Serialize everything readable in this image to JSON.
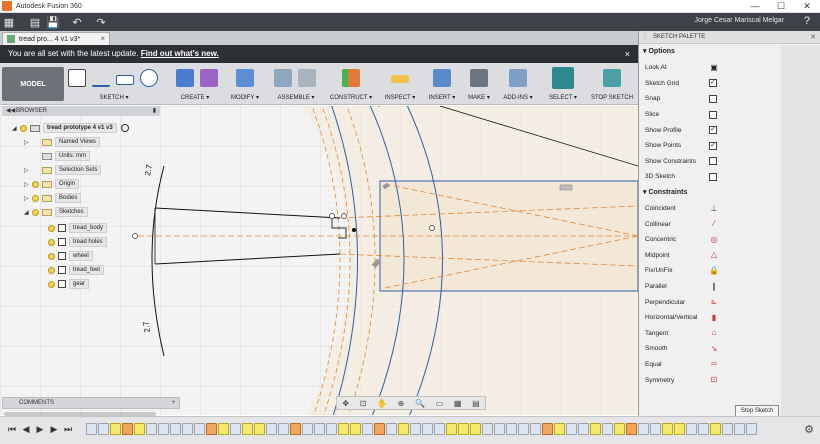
{
  "window": {
    "title": "Autodesk Fusion 360",
    "minimize": "—",
    "maximize": "☐",
    "close": "✕"
  },
  "qat": {
    "user": "Jorge Cesar Mariscal Melgar",
    "grid_icon": "▦",
    "file_icon": "▤",
    "save_icon": "💾",
    "undo_icon": "↶",
    "redo_icon": "↷",
    "help_icon": "?"
  },
  "document_tab": {
    "label": "tread pro... 4 v1 v3*",
    "close": "×"
  },
  "update_banner": {
    "text": "You are all set with the latest update.",
    "link": "Find out what's new.",
    "close": "×"
  },
  "toolbar": {
    "model": "MODEL",
    "groups": [
      "SKETCH ▾",
      "CREATE ▾",
      "MODIFY ▾",
      "ASSEMBLE ▾",
      "CONSTRUCT ▾",
      "INSPECT ▾",
      "INSERT ▾",
      "MAKE ▾",
      "ADD-INS ▾",
      "SELECT ▾",
      "STOP SKETCH"
    ]
  },
  "browser": {
    "header": "BROWSER",
    "root": "tread prototype 4 v1 v3",
    "items": [
      "Named Views",
      "Units: mm",
      "Selection Sets",
      "Origin",
      "Bodies",
      "Sketches"
    ],
    "sketches": [
      "tread_body",
      "tread holes",
      "wheel",
      "tread_feet",
      "gear"
    ]
  },
  "comments": {
    "label": "COMMENTS",
    "plus": "+"
  },
  "palette": {
    "header": "SKETCH PALETTE",
    "options_title": "Options",
    "options": [
      {
        "label": "Look At",
        "checked": null
      },
      {
        "label": "Sketch Grid",
        "checked": true
      },
      {
        "label": "Snap",
        "checked": false
      },
      {
        "label": "Slice",
        "checked": false
      },
      {
        "label": "Show Profile",
        "checked": true
      },
      {
        "label": "Show Points",
        "checked": true
      },
      {
        "label": "Show Constraints",
        "checked": false
      },
      {
        "label": "3D Sketch",
        "checked": false
      }
    ],
    "constraints_title": "Constraints",
    "constraints": [
      {
        "label": "Coincident",
        "icon": "⊥",
        "color": "#333333"
      },
      {
        "label": "Collinear",
        "icon": "⁄",
        "color": "#cc3333"
      },
      {
        "label": "Concentric",
        "icon": "◎",
        "color": "#cc3333"
      },
      {
        "label": "Midpoint",
        "icon": "△",
        "color": "#cc3333"
      },
      {
        "label": "Fix/UnFix",
        "icon": "🔒",
        "color": "#e07b1f"
      },
      {
        "label": "Parallel",
        "icon": "∥",
        "color": "#333333"
      },
      {
        "label": "Perpendicular",
        "icon": "⊾",
        "color": "#cc3333"
      },
      {
        "label": "Horizontal/Vertical",
        "icon": "▮",
        "color": "#cc3333"
      },
      {
        "label": "Tangent",
        "icon": "⌂",
        "color": "#cc3333"
      },
      {
        "label": "Smooth",
        "icon": "↘",
        "color": "#cc3333"
      },
      {
        "label": "Equal",
        "icon": "═",
        "color": "#cc3333"
      },
      {
        "label": "Symmetry",
        "icon": "⊡",
        "color": "#cc3333"
      }
    ],
    "stop_sketch": "Stop Sketch"
  },
  "canvas": {
    "dim_top": "2.7",
    "dim_bottom": "2.7"
  },
  "timeline": {
    "controls": [
      "⏮",
      "◀",
      "▶",
      "▶",
      "⏭"
    ]
  }
}
